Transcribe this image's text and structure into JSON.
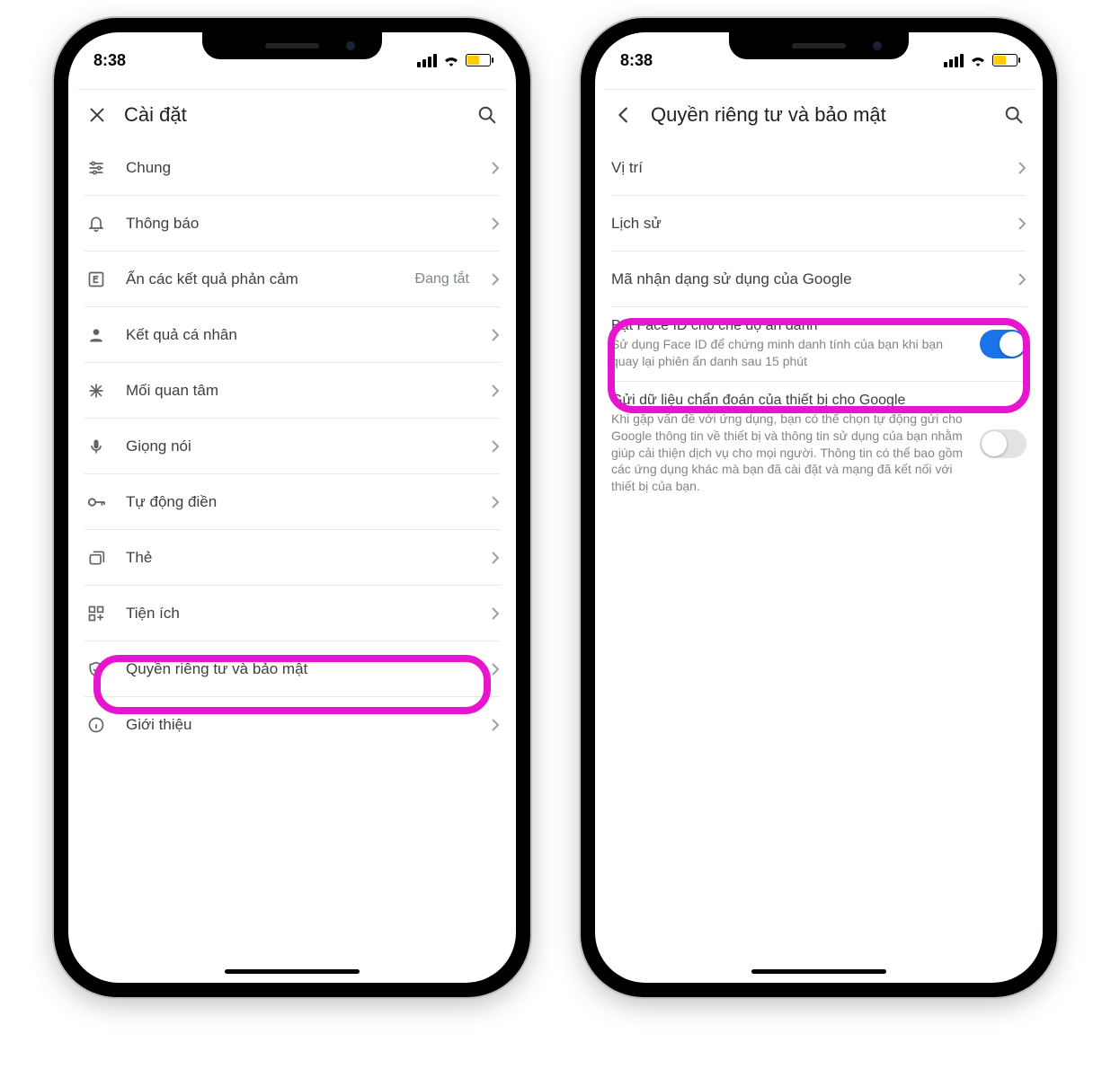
{
  "status": {
    "time": "8:38"
  },
  "phone1": {
    "title": "Cài đặt",
    "items": [
      {
        "icon": "tune",
        "label": "Chung"
      },
      {
        "icon": "bell",
        "label": "Thông báo"
      },
      {
        "icon": "explicit",
        "label": "Ẩn các kết quả phản cảm",
        "value": "Đang tắt"
      },
      {
        "icon": "person",
        "label": "Kết quả cá nhân"
      },
      {
        "icon": "asterisk",
        "label": "Mối quan tâm"
      },
      {
        "icon": "mic",
        "label": "Giọng nói"
      },
      {
        "icon": "key",
        "label": "Tự động điền"
      },
      {
        "icon": "cards",
        "label": "Thẻ"
      },
      {
        "icon": "widgets",
        "label": "Tiện ích"
      },
      {
        "icon": "shield",
        "label": "Quyền riêng tư và bảo mật",
        "highlight": true
      },
      {
        "icon": "info",
        "label": "Giới thiệu"
      }
    ]
  },
  "phone2": {
    "title": "Quyền riêng tư và bảo mật",
    "links": [
      {
        "label": "Vị trí"
      },
      {
        "label": "Lịch sử"
      },
      {
        "label": "Mã nhận dạng sử dụng của Google"
      }
    ],
    "toggles": [
      {
        "title": "Bật Face ID cho chế độ ẩn danh",
        "subtitle": "Sử dụng Face ID để chứng minh danh tính của bạn khi bạn quay lại phiên ẩn danh sau 15 phút",
        "on": true,
        "highlight": true
      },
      {
        "title": "Gửi dữ liệu chẩn đoán của thiết bị cho Google",
        "subtitle": "Khi gặp vấn đề với ứng dụng, bạn có thể chọn tự động gửi cho Google thông tin về thiết bị và thông tin sử dụng của bạn nhằm giúp cải thiện dịch vụ cho mọi người. Thông tin có thể bao gồm các ứng dụng khác mà bạn đã cài đặt và mạng đã kết nối với thiết bị của bạn.",
        "on": false
      }
    ]
  }
}
